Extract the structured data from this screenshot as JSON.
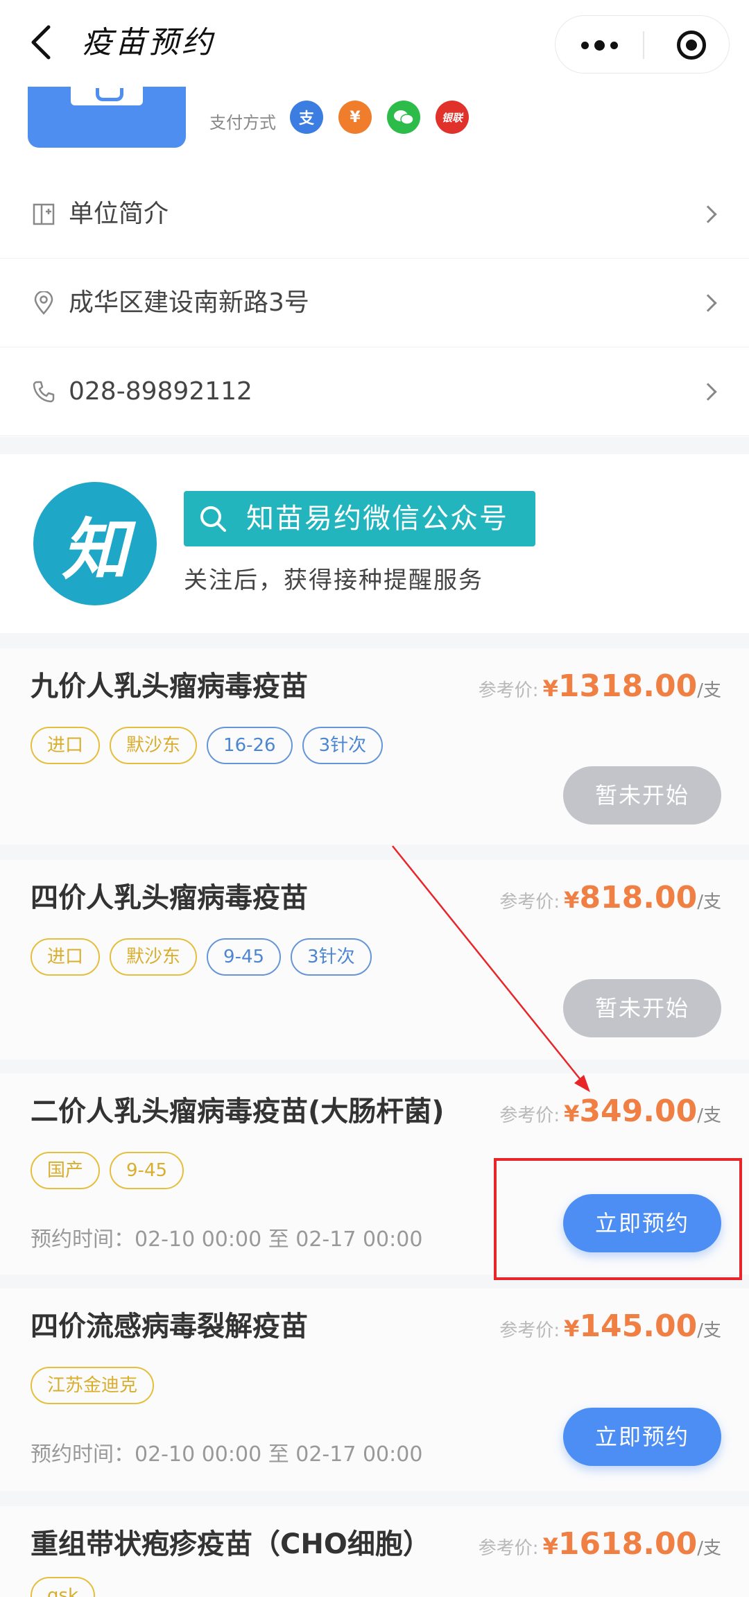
{
  "nav": {
    "title": "疫苗预约"
  },
  "org": {
    "pay_label": "支付方式",
    "pay_methods": [
      {
        "name": "alipay-icon",
        "glyph": "支"
      },
      {
        "name": "coin-icon",
        "glyph": "¥"
      },
      {
        "name": "wechat-pay-icon",
        "glyph": "●"
      },
      {
        "name": "unionpay-icon",
        "glyph": "银联"
      }
    ]
  },
  "info_rows": [
    {
      "label": "单位简介",
      "icon": "building-icon"
    },
    {
      "label": "成华区建设南新路3号",
      "icon": "location-pin-icon"
    },
    {
      "label": "028-89892112",
      "icon": "phone-icon"
    }
  ],
  "promo": {
    "logo_text": "知",
    "search_text": "知苗易约微信公众号",
    "subtitle": "关注后，获得接种提醒服务"
  },
  "price_label": "参考价:",
  "currency": "¥",
  "unit": "/支",
  "vaccines": [
    {
      "name": "九价人乳头瘤病毒疫苗",
      "price": "1318.00",
      "tags": [
        {
          "text": "进口",
          "color": "yellow"
        },
        {
          "text": "默沙东",
          "color": "yellow"
        },
        {
          "text": "16-26",
          "color": "blue"
        },
        {
          "text": "3针次",
          "color": "blue"
        }
      ],
      "time": "",
      "button": "暂未开始",
      "button_state": "disabled"
    },
    {
      "name": "四价人乳头瘤病毒疫苗",
      "price": "818.00",
      "tags": [
        {
          "text": "进口",
          "color": "yellow"
        },
        {
          "text": "默沙东",
          "color": "yellow"
        },
        {
          "text": "9-45",
          "color": "blue"
        },
        {
          "text": "3针次",
          "color": "blue"
        }
      ],
      "time": "",
      "button": "暂未开始",
      "button_state": "disabled"
    },
    {
      "name": "二价人乳头瘤病毒疫苗(大肠杆菌)",
      "price": "349.00",
      "tags": [
        {
          "text": "国产",
          "color": "yellow"
        },
        {
          "text": "9-45",
          "color": "yellow"
        }
      ],
      "time": "预约时间：02-10 00:00 至 02-17 00:00",
      "button": "立即预约",
      "button_state": "active"
    },
    {
      "name": "四价流感病毒裂解疫苗",
      "price": "145.00",
      "tags": [
        {
          "text": "江苏金迪克",
          "color": "yellow"
        }
      ],
      "time": "预约时间：02-10 00:00 至 02-17 00:00",
      "button": "立即预约",
      "button_state": "active"
    },
    {
      "name": "重组带状疱疹疫苗（CHO细胞）",
      "price": "1618.00",
      "tags": [
        {
          "text": "gsk",
          "color": "yellow"
        }
      ],
      "time": "",
      "button": "",
      "button_state": "none"
    }
  ],
  "colors": {
    "accent_blue": "#4d8ef4",
    "price_orange": "#f07f43",
    "annotation_red": "#e8262a"
  }
}
